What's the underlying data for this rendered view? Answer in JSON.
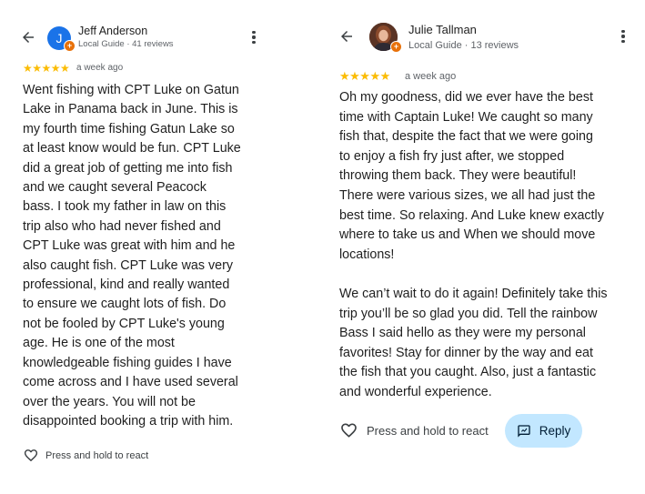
{
  "left_review": {
    "back_icon": "arrow-left-icon",
    "avatar_initial": "J",
    "avatar_color": "#1a73e8",
    "reviewer_name": "Jeff Anderson",
    "reviewer_meta": "Local Guide · 41 reviews",
    "more_icon": "more-vert-icon",
    "rating": 5,
    "stars": "★★★★★",
    "time_ago": "a week ago",
    "text": "Went fishing with CPT Luke on Gatun\nLake in Panama back in June. This is\nmy fourth time fishing Gatun Lake so\nat least know would be fun. CPT Luke\ndid a great job of getting me into fish\nand we caught several Peacock\nbass. I took my father in law on this\ntrip also who had never fished and\nCPT Luke was great with him and he\nalso caught fish. CPT Luke was very\nprofessional, kind and really wanted\nto ensure we caught lots of fish. Do\nnot be fooled by CPT Luke's young\nage. He is one of the most\nknowledgeable fishing guides I have\ncome across and I have used several\nover the years. You will not be\ndisappointed booking a trip with him.",
    "react_icon": "heart-outline-icon",
    "react_label": "Press and hold to react"
  },
  "right_review": {
    "back_icon": "arrow-left-icon",
    "reviewer_name": "Julie Tallman",
    "reviewer_meta": "Local Guide · 13 reviews",
    "more_icon": "more-vert-icon",
    "rating": 5,
    "stars": "★★★★★",
    "time_ago": "a week ago",
    "text": "Oh my goodness, did we ever have the best\ntime with Captain Luke! We caught so many\nfish that, despite the fact that we were going\nto enjoy a fish fry just after, we stopped\nthrowing them back. They were beautiful!\nThere were various sizes, we all had just the\nbest time. So relaxing. And Luke knew exactly\nwhere to take us and When we should move\nlocations!\n\nWe can’t wait to do it again! Definitely take this\ntrip you’ll be so glad you did. Tell the rainbow\nBass I said hello as they were my personal\nfavorites! Stay for dinner by the way and eat\nthe fish that you caught. Also, just a fantastic\nand wonderful experience.",
    "react_icon": "heart-outline-icon",
    "react_label": "Press and hold to react",
    "reply_icon": "reply-icon",
    "reply_label": "Reply"
  },
  "colors": {
    "star": "#fbbc04",
    "guide_badge": "#e8710a",
    "reply_background": "#c2e7ff"
  }
}
